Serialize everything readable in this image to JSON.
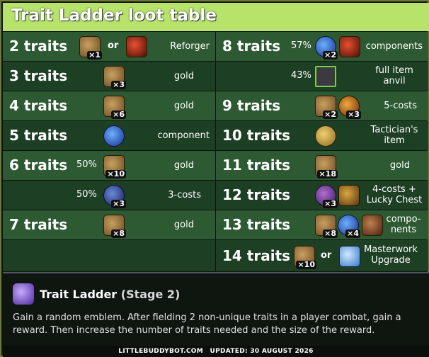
{
  "title": "Trait Ladder loot table",
  "left_rows": [
    {
      "trait": "2 traits",
      "pct": "",
      "counts": [
        "×1"
      ],
      "or": "or",
      "reward": "Reforger"
    },
    {
      "trait": "3 traits",
      "pct": "",
      "counts": [
        "×3"
      ],
      "reward": "gold"
    },
    {
      "trait": "4 traits",
      "pct": "",
      "counts": [
        "×6"
      ],
      "reward": "gold"
    },
    {
      "trait": "5 traits",
      "pct": "",
      "counts": [],
      "reward": "component"
    },
    {
      "trait": "6 traits",
      "pct": "50%",
      "counts": [
        "×10"
      ],
      "reward": "gold"
    },
    {
      "trait": "",
      "pct": "50%",
      "counts": [
        "×3"
      ],
      "reward": "3-costs"
    },
    {
      "trait": "7 traits",
      "pct": "",
      "counts": [
        "×8"
      ],
      "reward": "gold"
    },
    {
      "trait": "",
      "pct": "",
      "counts": [],
      "reward": ""
    }
  ],
  "right_rows": [
    {
      "trait": "8 traits",
      "pct": "57%",
      "counts": [
        "×2"
      ],
      "reward": "components"
    },
    {
      "trait": "",
      "pct": "43%",
      "counts": [],
      "reward": "full item anvil"
    },
    {
      "trait": "9 traits",
      "pct": "",
      "counts": [
        "×2",
        "×3"
      ],
      "reward": "5-costs"
    },
    {
      "trait": "10 traits",
      "pct": "",
      "counts": [],
      "reward": "Tactician's item"
    },
    {
      "trait": "11 traits",
      "pct": "",
      "counts": [
        "×18"
      ],
      "reward": "gold"
    },
    {
      "trait": "12 traits",
      "pct": "",
      "counts": [
        "×3"
      ],
      "reward": "4-costs + Lucky Chest"
    },
    {
      "trait": "13 traits",
      "pct": "",
      "counts": [
        "×8",
        "×4"
      ],
      "reward": "compo-nents"
    },
    {
      "trait": "14 traits",
      "pct": "",
      "counts": [
        "×10"
      ],
      "or": "or",
      "reward": "Masterwork Upgrade"
    }
  ],
  "augment": {
    "name": "Trait Ladder",
    "stage": "(Stage 2)",
    "description": "Gain a random emblem. After fielding 2 non-unique traits in a player combat, gain a reward. Then increase the number of traits needed and the size of the reward."
  },
  "footer": {
    "site": "LITTLEBUDDYBOT.COM",
    "updated": "UPDATED: 30 AUGUST 2026"
  },
  "colors": {
    "title_bg": "#b8e36a",
    "row_light": "#2e5a33",
    "row_dark": "#1d3f24"
  }
}
